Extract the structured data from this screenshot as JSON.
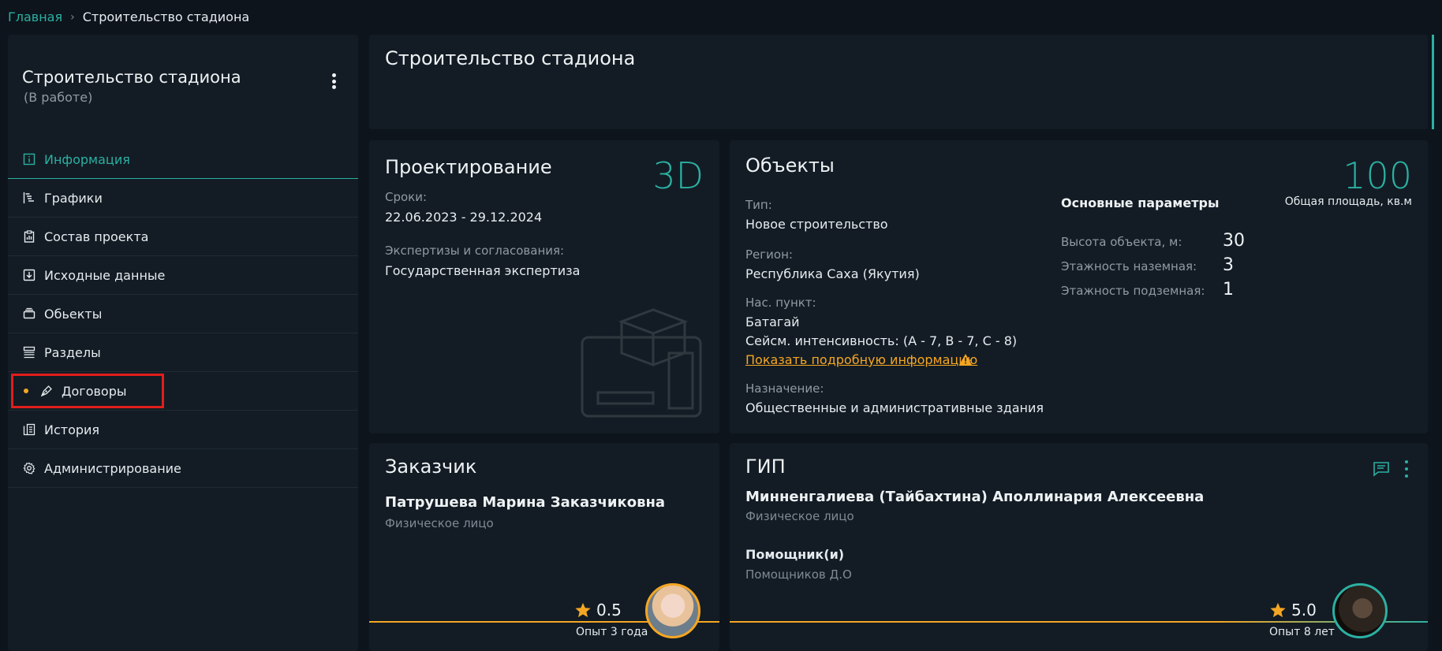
{
  "breadcrumb": {
    "home": "Главная",
    "current": "Строительство стадиона"
  },
  "sidebar": {
    "title": "Строительство стадиона",
    "status": "(В работе)",
    "items": [
      {
        "label": "Информация",
        "icon": "info-icon"
      },
      {
        "label": "Графики",
        "icon": "gantt-icon"
      },
      {
        "label": "Состав проекта",
        "icon": "clipboard-icon"
      },
      {
        "label": "Исходные данные",
        "icon": "download-icon"
      },
      {
        "label": "Обьекты",
        "icon": "layers-icon"
      },
      {
        "label": "Разделы",
        "icon": "sections-icon"
      },
      {
        "label": "Договоры",
        "icon": "pen-icon"
      },
      {
        "label": "История",
        "icon": "history-icon"
      },
      {
        "label": "Администрирование",
        "icon": "gear-icon"
      }
    ]
  },
  "header": {
    "title": "Строительство стадиона"
  },
  "design": {
    "title": "Проектирование",
    "badge": "3D",
    "dates_label": "Сроки:",
    "dates_value": "22.06.2023 - 29.12.2024",
    "expertise_label": "Экспертизы и согласования:",
    "expertise_value": "Государственная экспертиза"
  },
  "objects": {
    "title": "Объекты",
    "type_label": "Тип:",
    "type_value": "Новое строительство",
    "region_label": "Регион:",
    "region_value": "Республика Саха (Якутия)",
    "locality_label": "Нас. пункт:",
    "locality_value": "Батагай",
    "seismic": "Сейсм. интенсивность: (A - 7, B - 7, C - 8)",
    "details_link": "Показать подробную информацию",
    "purpose_label": "Назначение:",
    "purpose_value": "Общественные и административные здания",
    "area_value": "100",
    "area_label": "Общая площадь, кв.м",
    "params_title": "Основные параметры",
    "params": [
      {
        "label": "Высота объекта, м:",
        "value": "30"
      },
      {
        "label": "Этажность наземная:",
        "value": "3"
      },
      {
        "label": "Этажность подземная:",
        "value": "1"
      }
    ]
  },
  "customer": {
    "title": "Заказчик",
    "name": "Патрушева Марина Заказчиковна",
    "type": "Физическое лицо",
    "rating": "0.5",
    "experience": "Опыт 3 года"
  },
  "gip": {
    "title": "ГИП",
    "name": "Минненгалиева (Тайбахтина) Аполлинария Алексеевна",
    "type": "Физическое лицо",
    "assistant_label": "Помощник(и)",
    "assistant_value": "Помощников Д.О",
    "rating": "5.0",
    "experience": "Опыт 8 лет"
  },
  "colors": {
    "accent": "#2bb0a3",
    "warning": "#f5a623",
    "highlight": "#e21d1d"
  }
}
